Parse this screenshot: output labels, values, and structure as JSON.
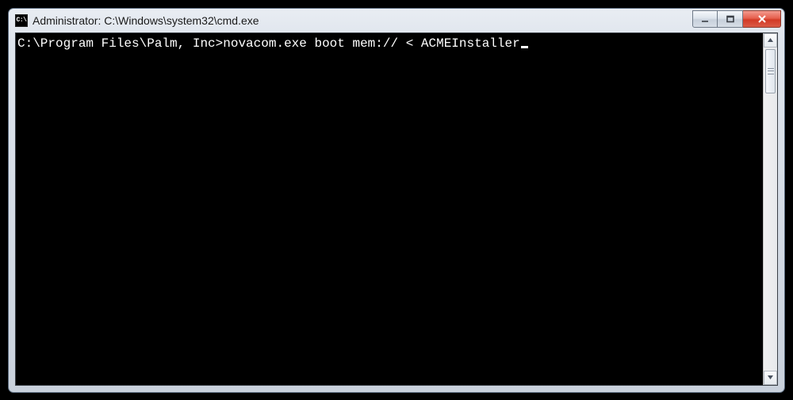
{
  "window": {
    "title": "Administrator: C:\\Windows\\system32\\cmd.exe",
    "icon_label": "C:\\"
  },
  "console": {
    "prompt": "C:\\Program Files\\Palm, Inc>",
    "command": "novacom.exe boot mem:// < ACMEInstaller"
  }
}
